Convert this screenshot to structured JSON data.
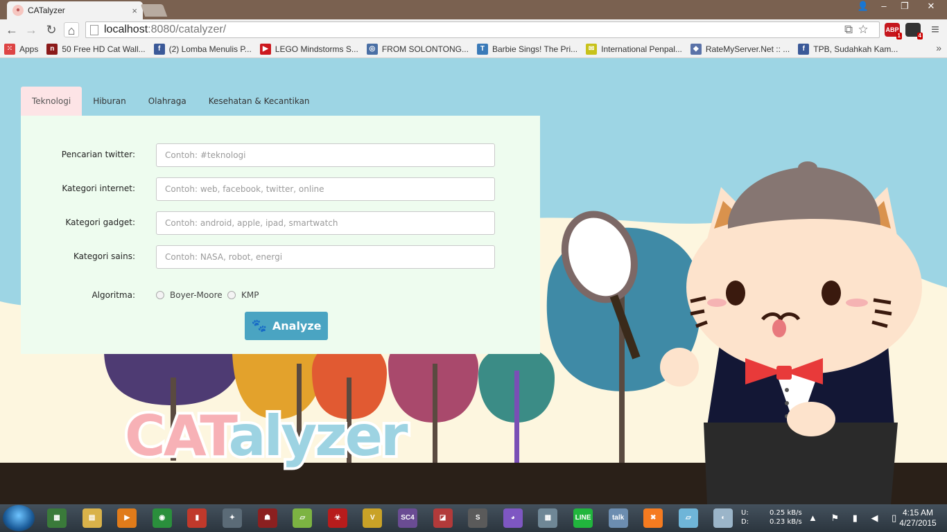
{
  "browser": {
    "tab_title": "CATalyzer",
    "tab_close": "×",
    "win_min": "‒",
    "win_max": "❐",
    "win_close": "✕",
    "url_host": "localhost",
    "url_path": ":8080/catalyzer/",
    "omnibox_icons": "⧉☆",
    "extensions": [
      {
        "label": "ABP",
        "count": "1",
        "color": "#c5161d"
      },
      {
        "label": "",
        "count": "4",
        "color": "#333333"
      }
    ],
    "menu_icon": "≡"
  },
  "bookmarks": [
    {
      "icon": "apps-grid-icon",
      "glyph": "⁙",
      "color": "#d44",
      "label": "Apps"
    },
    {
      "icon": "bookmark-n-icon",
      "glyph": "n",
      "color": "#8b1a1a",
      "label": "50 Free HD Cat Wall..."
    },
    {
      "icon": "facebook-icon",
      "glyph": "f",
      "color": "#3b5998",
      "label": "(2) Lomba Menulis P..."
    },
    {
      "icon": "youtube-icon",
      "glyph": "▶",
      "color": "#cc181e",
      "label": "LEGO Mindstorms S..."
    },
    {
      "icon": "globe-icon",
      "glyph": "◎",
      "color": "#4a6fa5",
      "label": "FROM SOLONTONG..."
    },
    {
      "icon": "bookmark-t-icon",
      "glyph": "T",
      "color": "#3a7ab8",
      "label": "Barbie Sings! The Pri..."
    },
    {
      "icon": "penpal-icon",
      "glyph": "✉",
      "color": "#c8c21a",
      "label": "International Penpal..."
    },
    {
      "icon": "server-icon",
      "glyph": "◆",
      "color": "#5a72a8",
      "label": "RateMyServer.Net :: ..."
    },
    {
      "icon": "facebook-icon",
      "glyph": "f",
      "color": "#3b5998",
      "label": "TPB, Sudahkah Kam..."
    }
  ],
  "bookmarks_more": "»",
  "tabs": [
    "Teknologi",
    "Hiburan",
    "Olahraga",
    "Kesehatan & Kecantikan"
  ],
  "form": {
    "fields": [
      {
        "label": "Pencarian twitter:",
        "placeholder": "Contoh: #teknologi"
      },
      {
        "label": "Kategori internet:",
        "placeholder": "Contoh: web, facebook, twitter, online"
      },
      {
        "label": "Kategori gadget:",
        "placeholder": "Contoh: android, apple, ipad, smartwatch"
      },
      {
        "label": "Kategori sains:",
        "placeholder": "Contoh: NASA, robot, energi"
      }
    ],
    "algo_label": "Algoritma:",
    "algo_options": [
      "Boyer-Moore",
      "KMP"
    ],
    "analyze_label": "Analyze",
    "paw_glyph": "🐾"
  },
  "logo": {
    "part1": "CAT",
    "part2": "alyzer"
  },
  "taskbar": {
    "apps": [
      {
        "icon": "task-manager-icon",
        "color": "#3a7a3a",
        "glyph": "▦"
      },
      {
        "icon": "explorer-icon",
        "color": "#d9b24a",
        "glyph": "▤"
      },
      {
        "icon": "media-player-icon",
        "color": "#e07b1a",
        "glyph": "▶"
      },
      {
        "icon": "chrome-icon",
        "color": "#2a8f3c",
        "glyph": "◉"
      },
      {
        "icon": "book-icon",
        "color": "#c0392b",
        "glyph": "▮"
      },
      {
        "icon": "counter-strike-icon",
        "color": "#5b6b77",
        "glyph": "✦"
      },
      {
        "icon": "helmet-icon",
        "color": "#8b2020",
        "glyph": "☗"
      },
      {
        "icon": "sticky-notes-icon",
        "color": "#7cb342",
        "glyph": "▱"
      },
      {
        "icon": "virus-icon",
        "color": "#b71c1c",
        "glyph": "☣"
      },
      {
        "icon": "v-app-icon",
        "color": "#c9a227",
        "glyph": "V"
      },
      {
        "icon": "sc4-icon",
        "color": "#6a4c93",
        "glyph": "SC4"
      },
      {
        "icon": "pdf-icon",
        "color": "#b23a3a",
        "glyph": "◪"
      },
      {
        "icon": "sublime-text-icon",
        "color": "#5a5a5a",
        "glyph": "S"
      },
      {
        "icon": "cat-app-icon",
        "color": "#7e57c2",
        "glyph": "◕"
      },
      {
        "icon": "calculator-icon",
        "color": "#6f8796",
        "glyph": "▦"
      },
      {
        "icon": "line-icon",
        "color": "#21b53d",
        "glyph": "LINE"
      },
      {
        "icon": "gtalk-icon",
        "color": "#6c8db0",
        "glyph": "talk"
      },
      {
        "icon": "xampp-icon",
        "color": "#f57b20",
        "glyph": "✖"
      },
      {
        "icon": "notepad-icon",
        "color": "#6fb5d8",
        "glyph": "▱"
      },
      {
        "icon": "paint-icon",
        "color": "#9bb5c9",
        "glyph": "◐"
      }
    ],
    "net_labels": "U:\nD:",
    "net_values": "0.25 kB/s\n0.23 kB/s",
    "tray_icons": "▲ ⚑ ▮ ◀ ▯",
    "time": "4:15 AM",
    "date": "4/27/2015"
  }
}
